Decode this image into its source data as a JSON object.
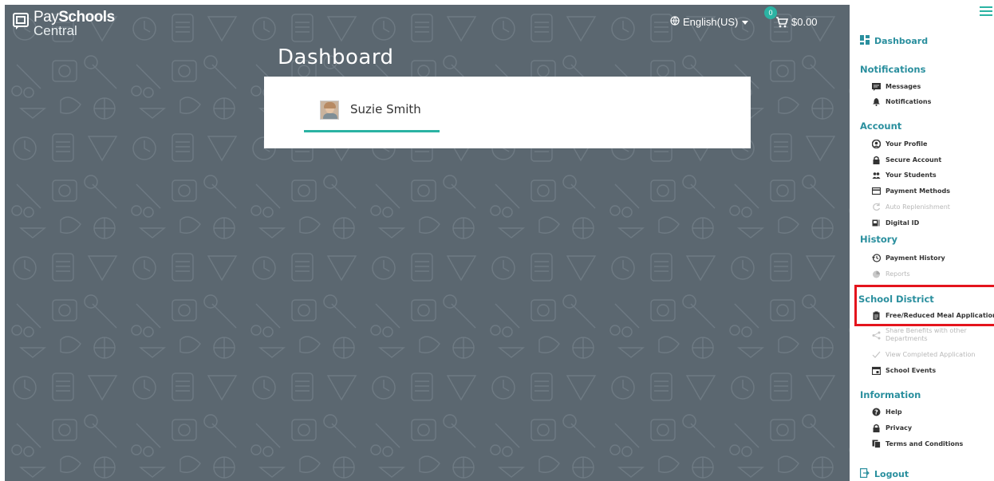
{
  "header": {
    "logo_pay": "Pay",
    "logo_schools": "Schools",
    "logo_central": "Central",
    "language": "English(US)",
    "cart_count": "0",
    "cart_total": "$0.00"
  },
  "main": {
    "title": "Dashboard",
    "student_name": "Suzie Smith"
  },
  "sidebar": {
    "dashboard": "Dashboard",
    "sections": {
      "notifications": {
        "label": "Notifications",
        "items": [
          "Messages",
          "Notifications"
        ]
      },
      "account": {
        "label": "Account",
        "items": [
          "Your Profile",
          "Secure Account",
          "Your Students",
          "Payment Methods",
          "Auto Replenishment",
          "Digital ID"
        ]
      },
      "history": {
        "label": "History",
        "items": [
          "Payment History",
          "Reports"
        ]
      },
      "school_district": {
        "label": "School District",
        "items": [
          "Free/Reduced Meal Application",
          "Share Benefits with other Departments",
          "View Completed Application",
          "School Events"
        ]
      },
      "information": {
        "label": "Information",
        "items": [
          "Help",
          "Privacy",
          "Terms and Conditions"
        ]
      }
    },
    "logout": "Logout"
  },
  "colors": {
    "accent": "#2bb3a3",
    "section_heading": "#2a8f9e",
    "main_background": "#5b6770",
    "highlight": "#e4141c"
  }
}
